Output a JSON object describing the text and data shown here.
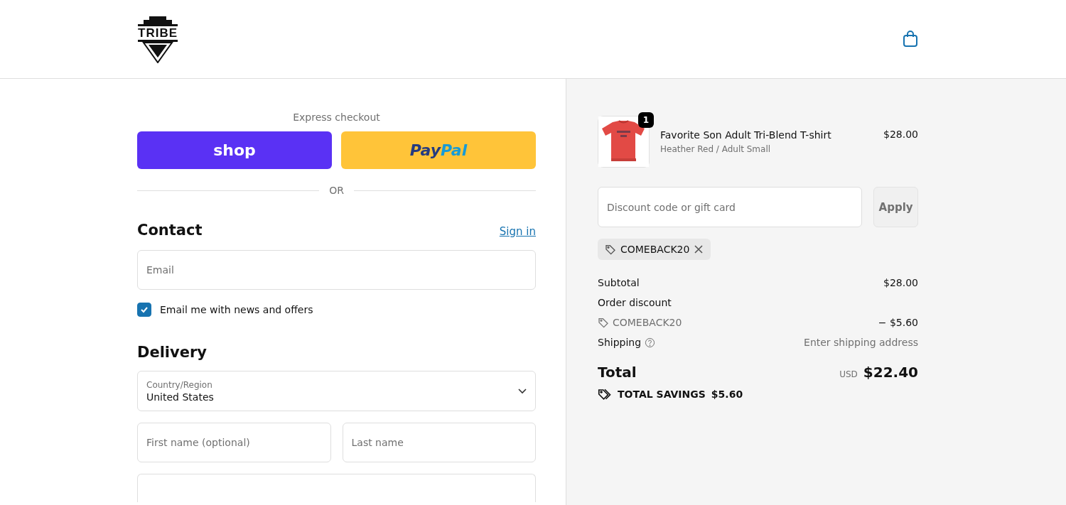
{
  "header": {
    "logo": "TRIBE"
  },
  "express": {
    "title": "Express checkout",
    "shop_label": "shop",
    "paypal_parts": [
      "Pay",
      "Pal"
    ],
    "divider": "OR"
  },
  "contact": {
    "heading": "Contact",
    "sign_in": "Sign in",
    "email": {
      "placeholder": "Email"
    },
    "news": {
      "label": "Email me with news and offers",
      "checked": true
    }
  },
  "delivery": {
    "heading": "Delivery",
    "country": {
      "label": "Country/Region",
      "value": "United States"
    },
    "fields": [
      {
        "placeholder": "First name (optional)"
      },
      {
        "placeholder": "Last name"
      }
    ]
  },
  "summary": {
    "items": [
      {
        "name": "Favorite Son Adult Tri-Blend T-shirt",
        "variant": "Heather Red / Adult Small",
        "price": "$28.00",
        "quantity": "1"
      }
    ],
    "discount": {
      "placeholder": "Discount code or gift card",
      "apply": "Apply",
      "applied": "COMEBACK20"
    },
    "lines": [
      {
        "kind": "plain",
        "label": "Subtotal",
        "value": "$28.00"
      },
      {
        "kind": "heading",
        "label": "Order discount"
      },
      {
        "kind": "code",
        "label": "COMEBACK20",
        "value": "− $5.60"
      },
      {
        "kind": "help",
        "label": "Shipping",
        "value": "Enter shipping address"
      }
    ],
    "total": {
      "label": "Total",
      "currency": "USD",
      "amount": "$22.40"
    },
    "savings": {
      "label": "TOTAL SAVINGS",
      "amount": "$5.60"
    }
  }
}
